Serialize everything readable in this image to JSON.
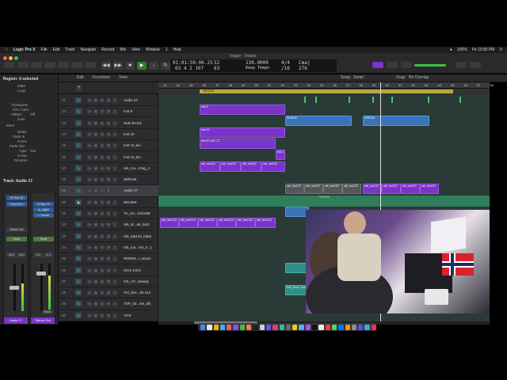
{
  "menubar": {
    "app": "Logic Pro X",
    "items": [
      "File",
      "Edit",
      "Track",
      "Navigate",
      "Record",
      "Mix",
      "View",
      "Window",
      "1",
      "Help"
    ],
    "clock": "Fri 10:50 PM",
    "battery": "100%"
  },
  "window": {
    "title": "Vogue - Tracks"
  },
  "lcd": {
    "position_top": "01:01:59:00.25",
    "position_bottom": "63  4  2  107",
    "beats_top": "52",
    "beats_bottom": "63",
    "tempo": "130.0000",
    "tempo_label": "Keep Tempo",
    "signature": "4/4",
    "division": "/16",
    "key": "Cmaj",
    "key_bottom": "276"
  },
  "toolbar": {
    "edit": "Edit",
    "functions": "Functions",
    "view": "View",
    "snap_label": "Snap:",
    "snap_value": "Smart",
    "drag_label": "Drag:",
    "drag_value": "No Overlap"
  },
  "inspector": {
    "region_header": "Region: 4 selected",
    "region_rows": [
      "Mute",
      "Loop",
      "Transpose",
      "Fine Tune",
      "Flatten",
      "Gain",
      "More",
      "Delay",
      "Fade In",
      "Curve",
      "Fade Out",
      "Type",
      "Curve",
      "Reverse"
    ],
    "fade_out_type": "Out",
    "flatten_value": "Off",
    "track_header": "Track: Audio 17",
    "strip1": {
      "slots": [
        "ID: Bus 36",
        "ShaperBox"
      ],
      "output": "Stereo Out",
      "mode": "Read",
      "vol": "-10.0",
      "pan": "-10.2",
      "name": "Audio 17"
    },
    "strip2": {
      "slots": [
        "Vertigo VS",
        "ta_digital",
        "L1 Master"
      ],
      "mode": "Read",
      "vol": "0.0",
      "pan": "-0.1",
      "name": "Stereo Out",
      "bounce": "Bnce"
    }
  },
  "ruler": {
    "ticks": [
      "41",
      "44",
      "45",
      "46",
      "47",
      "48",
      "49",
      "50",
      "51",
      "52",
      "53",
      "54",
      "55",
      "56",
      "57",
      "58",
      "59",
      "60",
      "61",
      "62",
      "63",
      "64",
      "65",
      "66",
      "67",
      "68"
    ]
  },
  "marker": {
    "label": "BRIDGE"
  },
  "tracks": [
    {
      "num": "11",
      "name": "Audio 23",
      "icon": "waveform-icon"
    },
    {
      "num": "12",
      "name": "Inst 9",
      "icon": "keyboard-icon"
    },
    {
      "num": "13",
      "name": "SUB BASS",
      "icon": "keyboard-icon"
    },
    {
      "num": "14",
      "name": "Inst 10",
      "icon": "keyboard-icon"
    },
    {
      "num": "15",
      "name": "Inst 10_kio",
      "icon": "keyboard-icon"
    },
    {
      "num": "16",
      "name": "Inst 10_kio",
      "icon": "keyboard-icon"
    },
    {
      "num": "17",
      "name": "rah_mu...tring_A",
      "icon": "waveform-icon"
    },
    {
      "num": "18",
      "name": "SERUM",
      "icon": "keyboard-icon"
    },
    {
      "num": "19",
      "name": "Audio 17",
      "icon": "waveform-icon"
    },
    {
      "num": "20",
      "name": "DRUMS",
      "icon": "folder-icon"
    },
    {
      "num": "21",
      "name": "TA_UH...ESAME",
      "icon": "waveform-icon"
    },
    {
      "num": "22",
      "name": "rah_dr...ak_hat1",
      "icon": "waveform-icon"
    },
    {
      "num": "23",
      "name": "rah_tap124_bakp",
      "icon": "waveform-icon"
    },
    {
      "num": "24",
      "name": "rah_ma...er2_F_1",
      "icon": "waveform-icon"
    },
    {
      "num": "25",
      "name": "RNRSS...l_wood",
      "icon": "waveform-icon"
    },
    {
      "num": "26",
      "name": "KICK KICK",
      "icon": "waveform-icon"
    },
    {
      "num": "27",
      "name": "OS_VV...beauty",
      "icon": "waveform-icon"
    },
    {
      "num": "28",
      "name": "GH_Dru...de.124",
      "icon": "waveform-icon"
    },
    {
      "num": "29",
      "name": "TSP_02...em_kik",
      "icon": "waveform-icon"
    },
    {
      "num": "30",
      "name": "VOX",
      "icon": "waveform-icon"
    }
  ],
  "regions": {
    "inst9": "Inst 9",
    "serum": "SERUM",
    "inst10": "Inst 10",
    "inst10_kio": "Inst 10_kio 1.0",
    "inst": "Inst 1",
    "rah_mu": "rah_mu122",
    "rah_mm": "rah_mu122",
    "rah_dr": "rah_drm124",
    "drums": "DRUMS",
    "gh": "GH_Drum_Loo"
  }
}
